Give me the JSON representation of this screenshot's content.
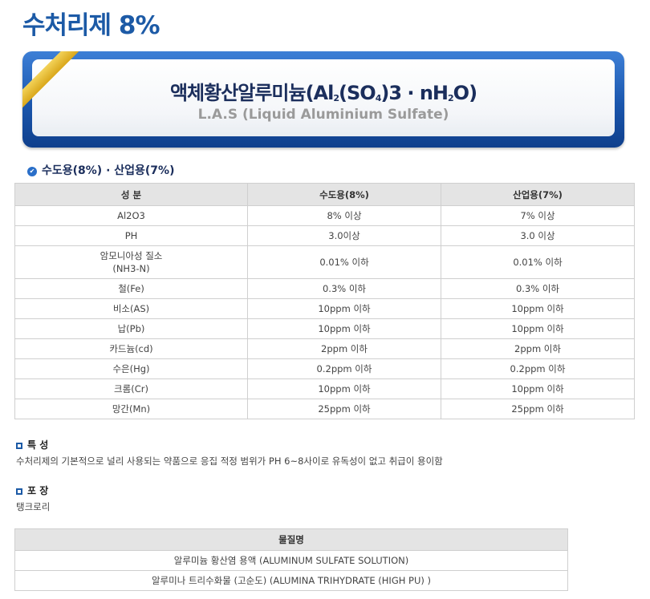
{
  "page_title": "수처리제 8%",
  "banner": {
    "title_main": "액체황산알루미늄(Al",
    "title_sub1": "2",
    "title_mid": "(SO",
    "title_sub2": "4",
    "title_mid2": ")3 · nH",
    "title_sub3": "2",
    "title_end": "O)",
    "subtitle": "L.A.S (Liquid Aluminium Sulfate)"
  },
  "section_title": "수도용(8%) · 산업용(7%)",
  "spec_table": {
    "headers": [
      "성 분",
      "수도용(8%)",
      "산업용(7%)"
    ],
    "rows": [
      [
        "Al2O3",
        "8% 이상",
        "7% 이상"
      ],
      [
        "PH",
        "3.0이상",
        "3.0 이상"
      ],
      [
        "암모니아성 질소\n(NH3-N)",
        "0.01% 이하",
        "0.01% 이하"
      ],
      [
        "철(Fe)",
        "0.3% 이하",
        "0.3% 이하"
      ],
      [
        "비소(AS)",
        "10ppm 이하",
        "10ppm 이하"
      ],
      [
        "납(Pb)",
        "10ppm 이하",
        "10ppm 이하"
      ],
      [
        "카드늄(cd)",
        "2ppm 이하",
        "2ppm 이하"
      ],
      [
        "수은(Hg)",
        "0.2ppm 이하",
        "0.2ppm 이하"
      ],
      [
        "크롬(Cr)",
        "10ppm 이하",
        "10ppm 이하"
      ],
      [
        "망간(Mn)",
        "25ppm 이하",
        "25ppm 이하"
      ]
    ]
  },
  "features": {
    "title": "특 성",
    "text": "수처리제의 기본적으로 널리 사용되는 약품으로 응집 적정 범위가 PH 6~8사이로 유독성이 없고 취급이 용이함"
  },
  "packaging": {
    "title": "포 장",
    "text": "탱크로리"
  },
  "material_table": {
    "header": "물질명",
    "rows": [
      "알루미늄 황산염 용액 (ALUMINUM SULFATE SOLUTION)",
      "알루미나 트리수화물 (고순도) (ALUMINA TRIHYDRATE (HIGH PU) )"
    ]
  }
}
